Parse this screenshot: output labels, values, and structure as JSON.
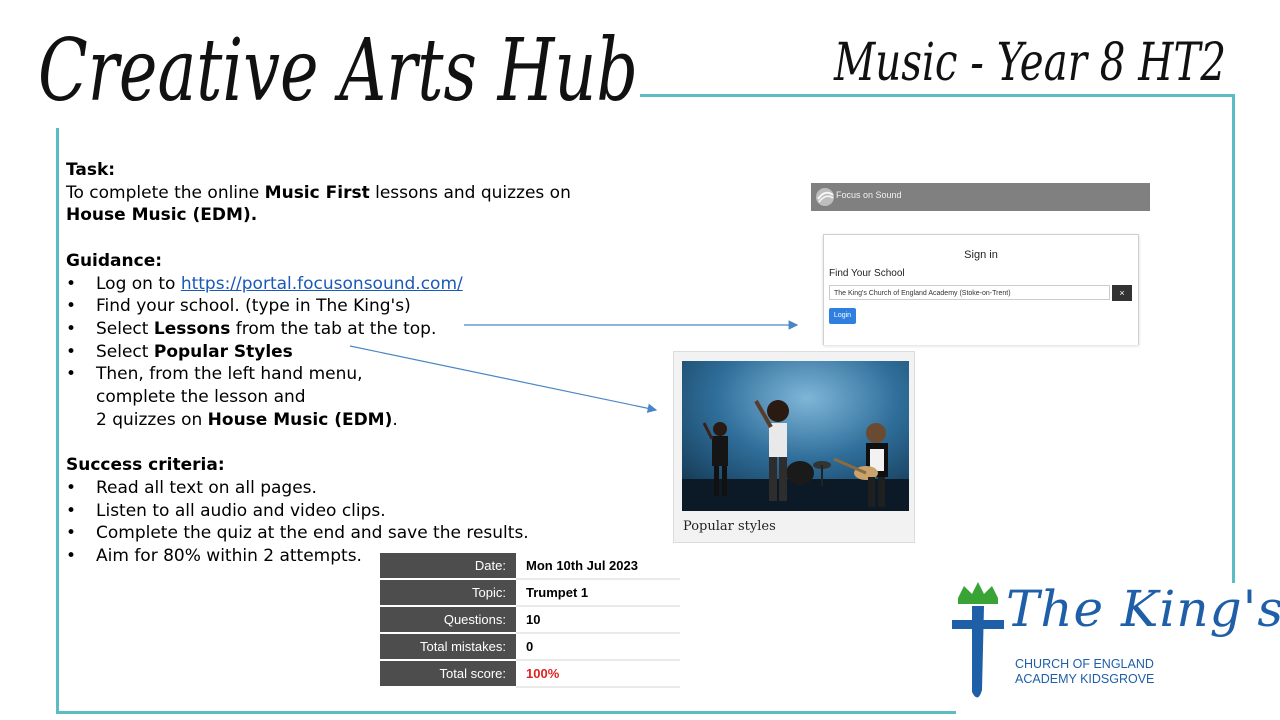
{
  "header": {
    "title": "Creative Arts Hub",
    "subtitle": "Music - Year 8 HT2"
  },
  "task": {
    "heading": "Task:",
    "line1_pre": "To complete the  online ",
    "line1_bold": "Music First",
    "line1_post": " lessons and quizzes on",
    "line2_bold": "House Music (EDM)."
  },
  "guidance": {
    "heading": "Guidance:",
    "bullet": "•",
    "item1_pre": "Log on to ",
    "item1_link": "https://portal.focusonsound.com/",
    "item2": "Find your school. (type in The King's)",
    "item3_pre": "Select ",
    "item3_bold": "Lessons",
    "item3_post": " from the tab at the top.",
    "item4_pre": "Select ",
    "item4_bold": "Popular Styles",
    "item5_line1": "Then, from the left hand menu,",
    "item5_line2": "complete the lesson and",
    "item5_line3_pre": "2 quizzes on ",
    "item5_line3_bold": "House Music (EDM)",
    "item5_line3_post": "."
  },
  "success": {
    "heading": "Success criteria:",
    "items": [
      "Read all text on all pages.",
      "Listen to all audio and video clips.",
      "Complete the quiz at the end and save the results.",
      "Aim for 80% within 2 attempts."
    ]
  },
  "focus_screenshot": {
    "logo_text": "Focus on Sound",
    "signin_title": "Sign in",
    "find_school_label": "Find Your School",
    "school_value": "The King's Church of England Academy (Stoke-on-Trent)",
    "clear_button": "×",
    "login_button": "Login"
  },
  "popular_card": {
    "caption": "Popular styles"
  },
  "results": {
    "rows": [
      {
        "label": "Date:",
        "value": "Mon 10th Jul 2023"
      },
      {
        "label": "Topic:",
        "value": "Trumpet 1"
      },
      {
        "label": "Questions:",
        "value": "10"
      },
      {
        "label": "Total mistakes:",
        "value": "0"
      },
      {
        "label": "Total score:",
        "value": "100%"
      }
    ],
    "score_color": "#e02222"
  },
  "school_logo": {
    "name": "The King's",
    "line1": "CHURCH OF ENGLAND",
    "line2": "ACADEMY KIDSGROVE"
  },
  "colors": {
    "frame": "#5bbcc4",
    "arrow": "#4a86c5",
    "logo_blue": "#1e5fa8",
    "logo_green": "#3aa335"
  }
}
